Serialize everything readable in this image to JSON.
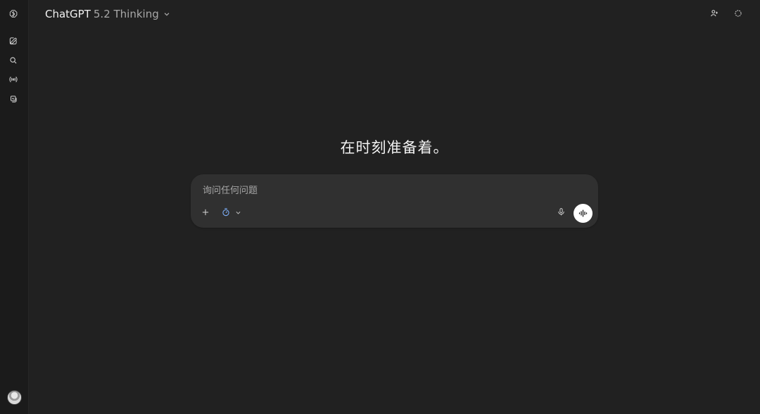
{
  "header": {
    "model_name": "ChatGPT",
    "model_version": "5.2 Thinking"
  },
  "main": {
    "hero_text": "在时刻准备着。"
  },
  "composer": {
    "placeholder": "询问任何问题",
    "value": ""
  },
  "icons": {
    "logo": "openai-logo-icon",
    "new_chat": "new-chat-icon",
    "search": "search-icon",
    "broadcast": "broadcast-icon",
    "library": "library-icon",
    "profile": "profile-icon",
    "refresh": "refresh-icon",
    "add": "plus-icon",
    "thinking": "thinking-mode-icon",
    "microphone": "microphone-icon",
    "voice": "voice-wave-icon",
    "dropdown": "chevron-down-icon"
  },
  "colors": {
    "background": "#212121",
    "composer": "#303030",
    "accent": "#7fb3ff"
  }
}
